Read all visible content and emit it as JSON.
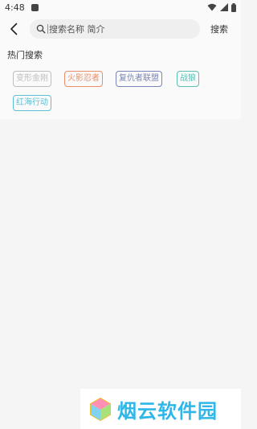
{
  "status_bar": {
    "time": "4:48"
  },
  "header": {
    "search_placeholder": "搜索名称 简介",
    "search_button": "搜索"
  },
  "hot": {
    "title": "热门搜索",
    "tags": [
      {
        "label": "变形金刚",
        "color": "#bdbdbd"
      },
      {
        "label": "火影忍者",
        "color": "#e8906b"
      },
      {
        "label": "复仇者联盟",
        "color": "#7c85b9"
      },
      {
        "label": "战狼",
        "color": "#5cbfb3"
      },
      {
        "label": "红海行动",
        "color": "#5cbfd6"
      }
    ]
  },
  "watermark": {
    "text": "烟云软件园"
  }
}
